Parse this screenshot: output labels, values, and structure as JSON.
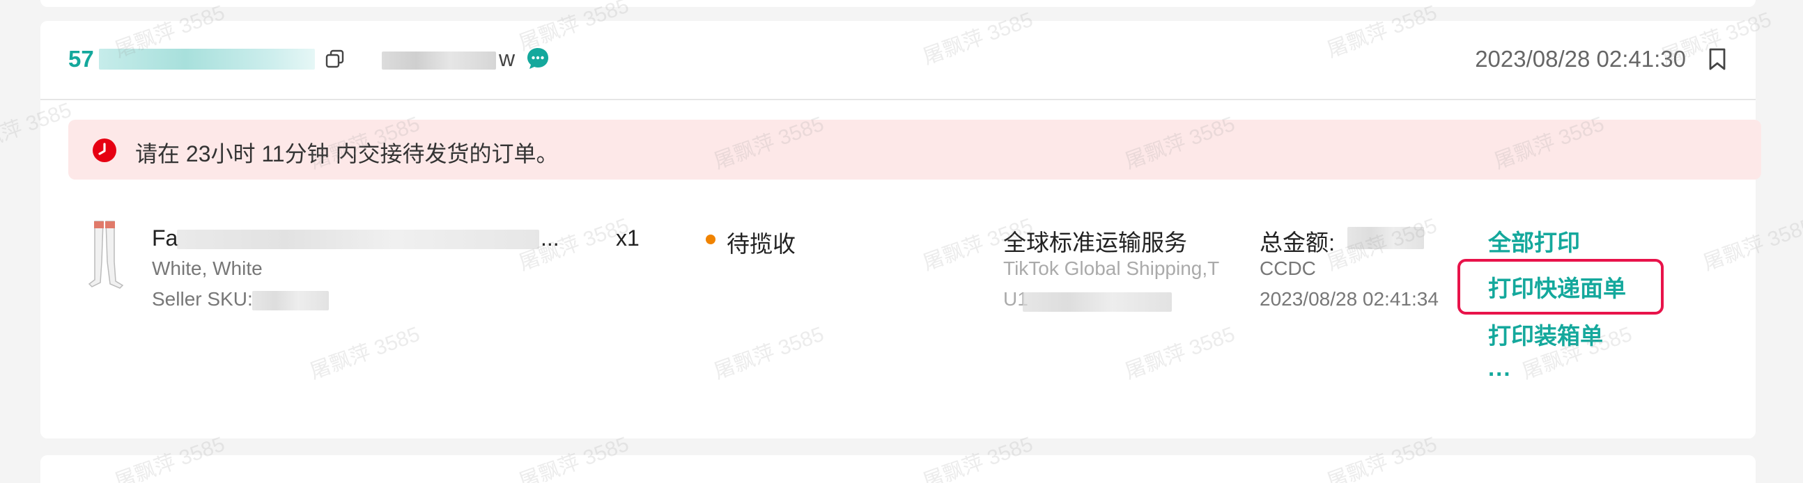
{
  "order": {
    "id_prefix": "57",
    "buyer_prefix": "",
    "buyer_suffix": "w",
    "order_time": "2023/08/28 02:41:30"
  },
  "alert": {
    "text": "请在 23小时 11分钟 内交接待发货的订单。"
  },
  "product": {
    "name_prefix": "Fa",
    "name_ellipsis": "... ",
    "quantity": "x1",
    "variant": "White, White",
    "sku_label": "Seller SKU:"
  },
  "status": {
    "label": "待揽收",
    "dot_color": "#f08300"
  },
  "shipping": {
    "service": "全球标准运输服务",
    "provider": "TikTok Global Shipping,T",
    "tracking_prefix": "U1"
  },
  "amount": {
    "label": "总金额:",
    "currency": "CCDC",
    "time": "2023/08/28 02:41:34"
  },
  "actions": {
    "print_all": "全部打印",
    "print_express": "打印快递面单",
    "print_packing": "打印装箱单",
    "more": "..."
  },
  "watermark": {
    "text": "屠飘萍 3585"
  },
  "colors": {
    "accent": "#14a89c",
    "alert_bg": "#fde8e8",
    "alert_icon": "#e60012",
    "highlight": "#e8134a"
  }
}
